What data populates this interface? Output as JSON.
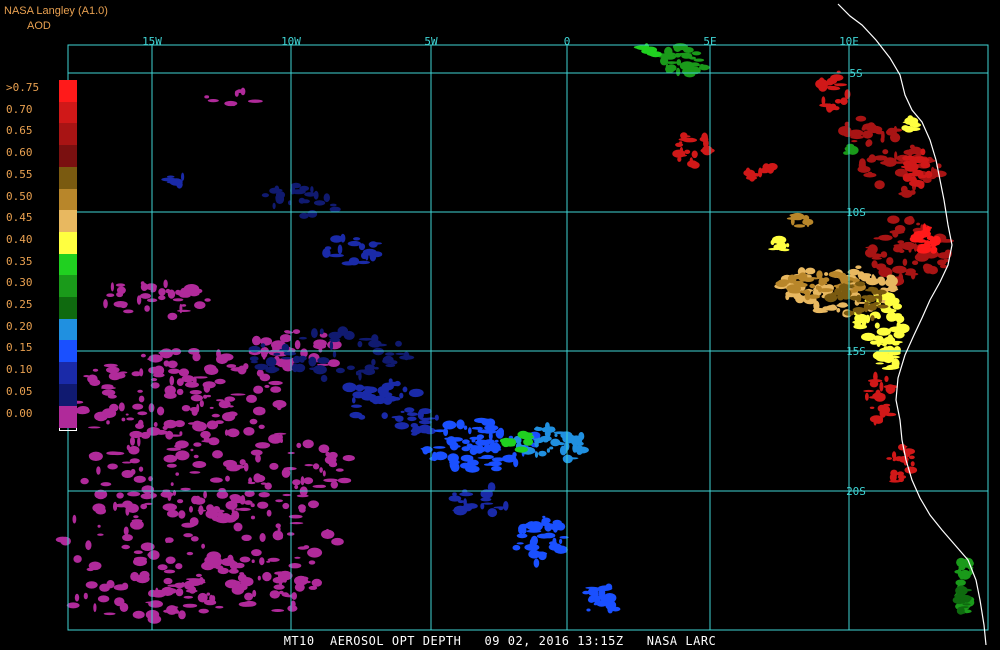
{
  "header": {
    "title": "NASA Langley (A1.0)",
    "subtitle": "AOD"
  },
  "legend": {
    "labels": [
      ">0.75",
      "0.70",
      "0.65",
      "0.60",
      "0.55",
      "0.50",
      "0.45",
      "0.40",
      "0.35",
      "0.30",
      "0.25",
      "0.20",
      "0.15",
      "0.10",
      "0.05",
      "0.00"
    ],
    "colors": [
      "#ff1a1a",
      "#d01818",
      "#a81414",
      "#7a1010",
      "#7a5a10",
      "#b8862a",
      "#e8b860",
      "#ffff40",
      "#20d020",
      "#1a9a1a",
      "#0f6a0f",
      "#2090e0",
      "#1a50ff",
      "#1a2aa8",
      "#101a70",
      "#b02a9a"
    ]
  },
  "axes": {
    "lon_labels": [
      "15W",
      "10W",
      "5W",
      "0",
      "5E",
      "10E"
    ],
    "lat_labels": [
      "5S",
      "10S",
      "15S",
      "20S"
    ]
  },
  "footer": {
    "text": "MT10  AEROSOL OPT DEPTH   09 02, 2016 13:15Z   NASA LARC"
  },
  "colors": {
    "grid": "#3fd4d4",
    "coast": "#ffffff",
    "background": "#000000"
  }
}
